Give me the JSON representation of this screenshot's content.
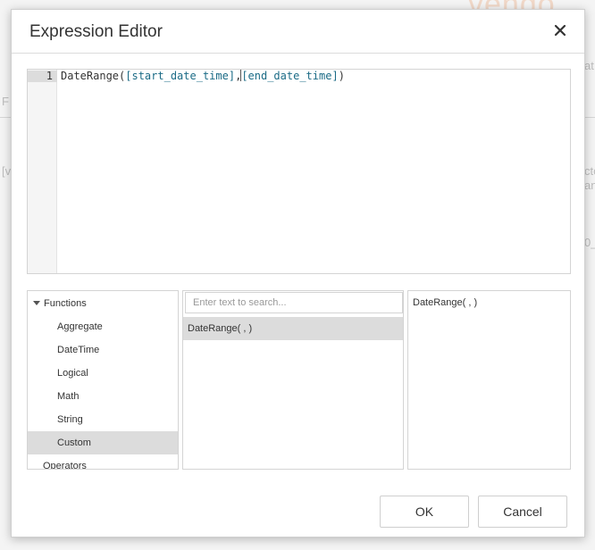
{
  "background": {
    "brand_text": "vendo",
    "left_texts": [
      "F",
      "[v"
    ],
    "right_texts": [
      "at",
      "cto",
      "an",
      "0_"
    ]
  },
  "dialog": {
    "title": "Expression Editor",
    "close_icon": "close-icon"
  },
  "editor": {
    "line_number": "1",
    "code": {
      "func": "DateRange(",
      "arg1": "[start_date_time]",
      "sep": ",",
      "arg2": "[end_date_time]",
      "close": ")"
    }
  },
  "tree": {
    "items": [
      {
        "label": "Functions",
        "expanded": true
      },
      {
        "label": "Aggregate"
      },
      {
        "label": "DateTime"
      },
      {
        "label": "Logical"
      },
      {
        "label": "Math"
      },
      {
        "label": "String"
      },
      {
        "label": "Custom",
        "selected": true
      },
      {
        "label": "Operators"
      }
    ]
  },
  "list": {
    "search_placeholder": "Enter text to search...",
    "items": [
      "DateRange( , )"
    ]
  },
  "description": {
    "text": "DateRange( , )"
  },
  "buttons": {
    "ok": "OK",
    "cancel": "Cancel"
  }
}
